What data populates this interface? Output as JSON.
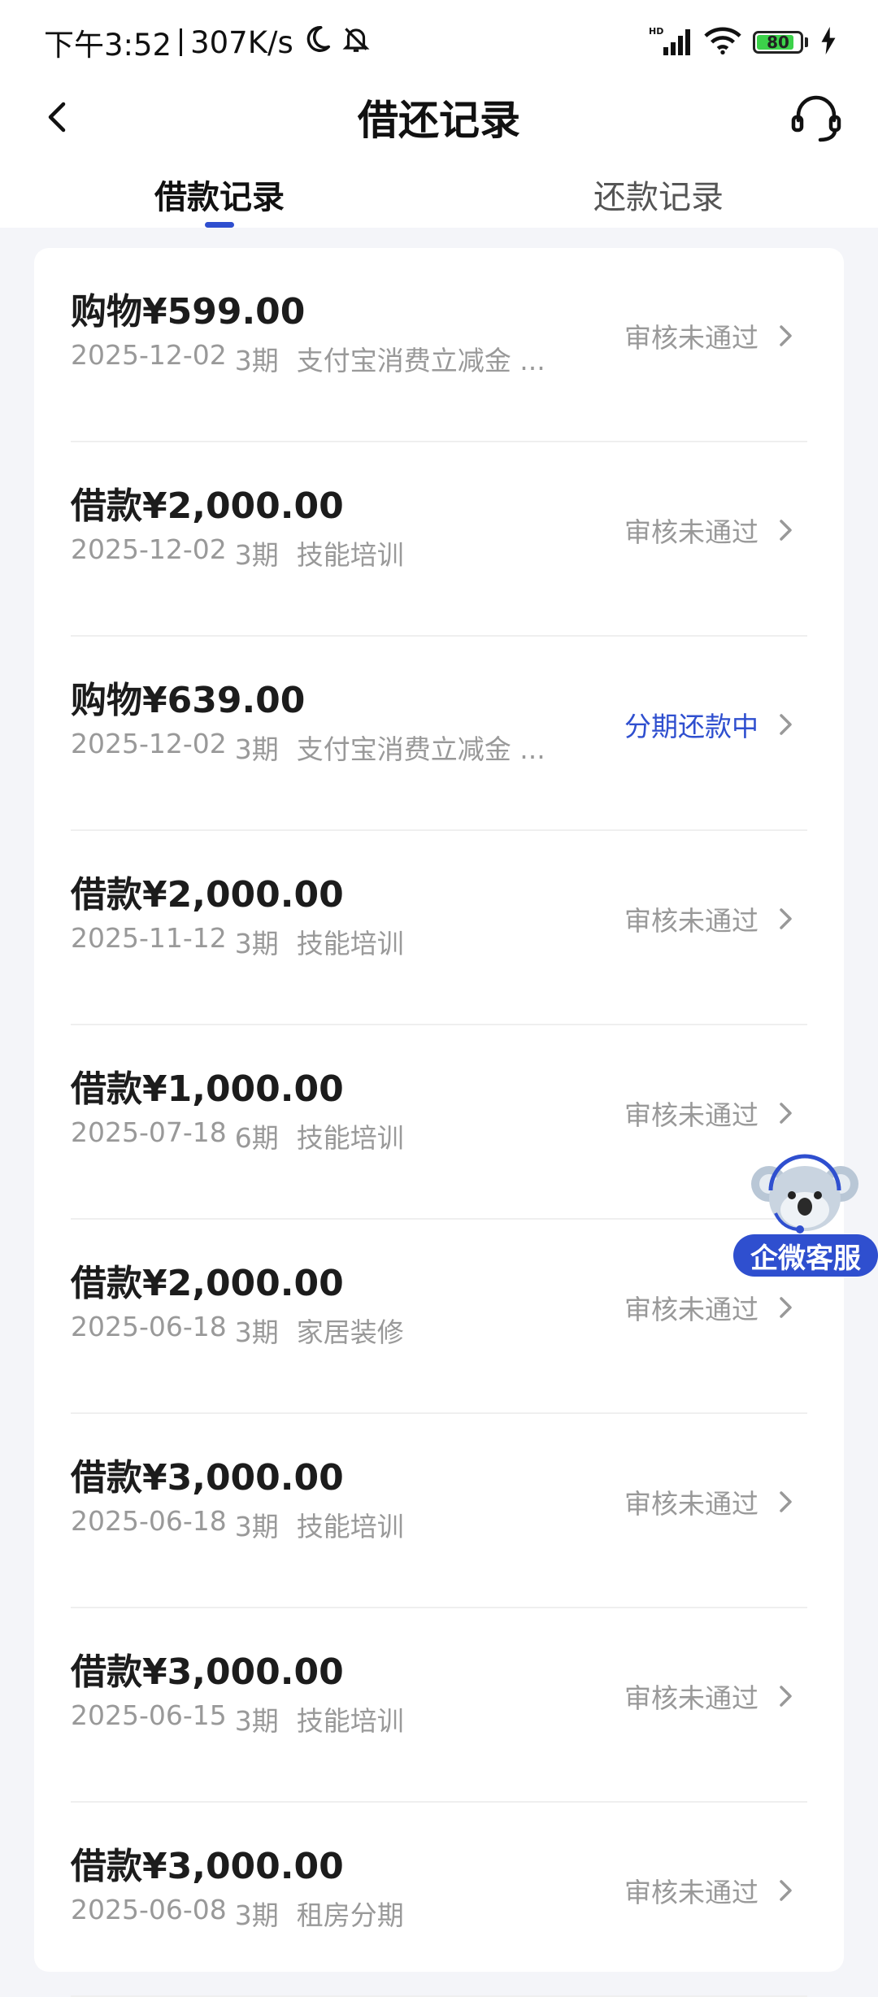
{
  "theme": {
    "accent": "#2f4fcf",
    "muted_text": "#999999",
    "page_bg": "#f4f5f9"
  },
  "status_bar": {
    "time": "下午3:52",
    "net_speed": "307K/s",
    "battery": "80",
    "icons": [
      "moon-icon",
      "mute-bell-icon",
      "hd-signal-icon",
      "wifi-icon",
      "battery-icon",
      "charging-icon"
    ]
  },
  "nav": {
    "title": "借还记录",
    "back_icon": "chevron-left-icon",
    "service_icon": "headset-icon"
  },
  "tabs": [
    {
      "label": "借款记录",
      "active": true
    },
    {
      "label": "还款记录",
      "active": false
    }
  ],
  "records": [
    {
      "amount": "购物¥599.00",
      "date": "2025-12-02",
      "term": "3期",
      "purpose": "支付宝消费立减金 ...",
      "status": "审核未通过",
      "active": false
    },
    {
      "amount": "借款¥2,000.00",
      "date": "2025-12-02",
      "term": "3期",
      "purpose": "技能培训",
      "status": "审核未通过",
      "active": false
    },
    {
      "amount": "购物¥639.00",
      "date": "2025-12-02",
      "term": "3期",
      "purpose": "支付宝消费立减金 ...",
      "status": "分期还款中",
      "active": true
    },
    {
      "amount": "借款¥2,000.00",
      "date": "2025-11-12",
      "term": "3期",
      "purpose": "技能培训",
      "status": "审核未通过",
      "active": false
    },
    {
      "amount": "借款¥1,000.00",
      "date": "2025-07-18",
      "term": "6期",
      "purpose": "技能培训",
      "status": "审核未通过",
      "active": false
    },
    {
      "amount": "借款¥2,000.00",
      "date": "2025-06-18",
      "term": "3期",
      "purpose": "家居装修",
      "status": "审核未通过",
      "active": false
    },
    {
      "amount": "借款¥3,000.00",
      "date": "2025-06-18",
      "term": "3期",
      "purpose": "技能培训",
      "status": "审核未通过",
      "active": false
    },
    {
      "amount": "借款¥3,000.00",
      "date": "2025-06-15",
      "term": "3期",
      "purpose": "技能培训",
      "status": "审核未通过",
      "active": false
    },
    {
      "amount": "借款¥3,000.00",
      "date": "2025-06-08",
      "term": "3期",
      "purpose": "租房分期",
      "status": "审核未通过",
      "active": false
    }
  ],
  "float_service": {
    "label": "企微客服",
    "icon": "koala-mascot-icon"
  }
}
